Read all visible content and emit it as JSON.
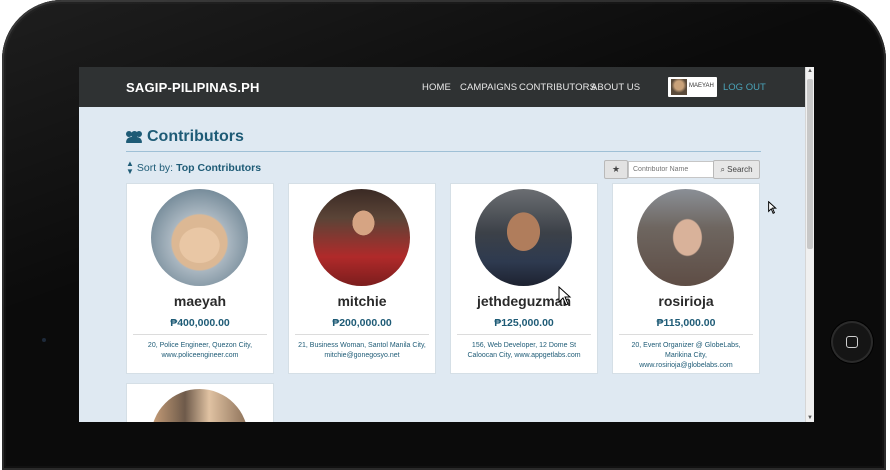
{
  "navbar": {
    "brand": "SAGIP-PILIPINAS.PH",
    "links": [
      "HOME",
      "CAMPAIGNS",
      "CONTRIBUTORS",
      "ABOUT US"
    ],
    "user_name": "MAEYAH",
    "logout_label": "LOG OUT"
  },
  "section": {
    "title": "Contributors",
    "sort_label": "Sort by:",
    "sort_value": "Top Contributors"
  },
  "search": {
    "placeholder": "Contributor Name",
    "button_label": "Search"
  },
  "contributors": [
    {
      "name": "maeyah",
      "amount": "₱400,000.00",
      "desc": "20, Police Engineer, Quezon City, www.policeengineer.com"
    },
    {
      "name": "mitchie",
      "amount": "₱200,000.00",
      "desc": "21, Business Woman, Santol Manila City, mitchie@gonegosyo.net"
    },
    {
      "name": "jethdeguzman",
      "amount": "₱125,000.00",
      "desc": "156, Web Developer, 12 Dome St Caloocan City, www.appgetlabs.com"
    },
    {
      "name": "rosirioja",
      "amount": "₱115,000.00",
      "desc": "20, Event Organizer @ GlobeLabs, Marikina City, www.rosirioja@globelabs.com"
    }
  ],
  "colors": {
    "navbar_bg": "#2f3233",
    "accent": "#1e5b76",
    "page_bg": "#dfe9f2",
    "logout": "#4aa3b8"
  },
  "icons": [
    "users-icon",
    "sort-icon",
    "star-icon",
    "search-icon",
    "home-button-icon",
    "cursor-icon"
  ]
}
